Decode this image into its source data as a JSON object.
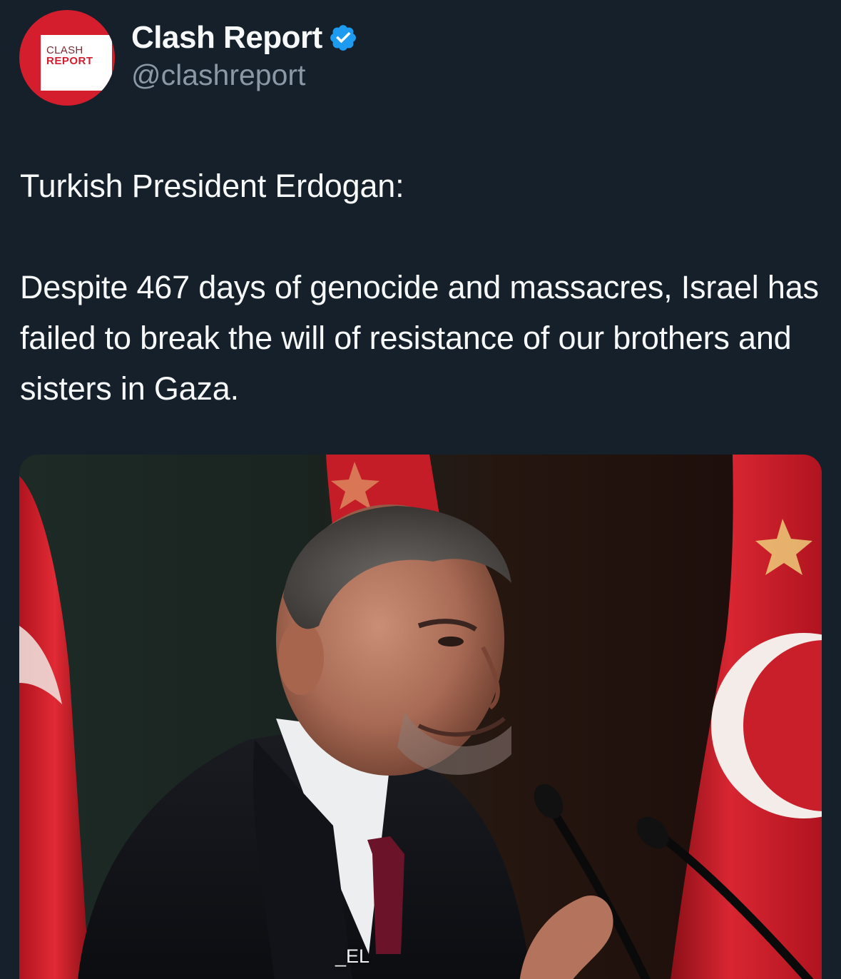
{
  "author": {
    "display_name": "Clash Report",
    "handle": "@clashreport",
    "verified": true,
    "avatar": {
      "logo_top": "CLASH",
      "logo_bottom": "REPORT",
      "background_color": "#d41d2d"
    }
  },
  "tweet": {
    "line1": "Turkish President Erdogan:",
    "line2": "Despite 467 days of genocide and massacres, Israel has failed to break the will of resistance of our brothers and sisters in Gaza."
  },
  "media": {
    "watermark": "_EL"
  },
  "colors": {
    "background": "#15202b",
    "text": "#f7f9f9",
    "secondary_text": "#8b98a5",
    "verified_blue": "#1d9bf0",
    "flag_red": "#d31f2a"
  }
}
